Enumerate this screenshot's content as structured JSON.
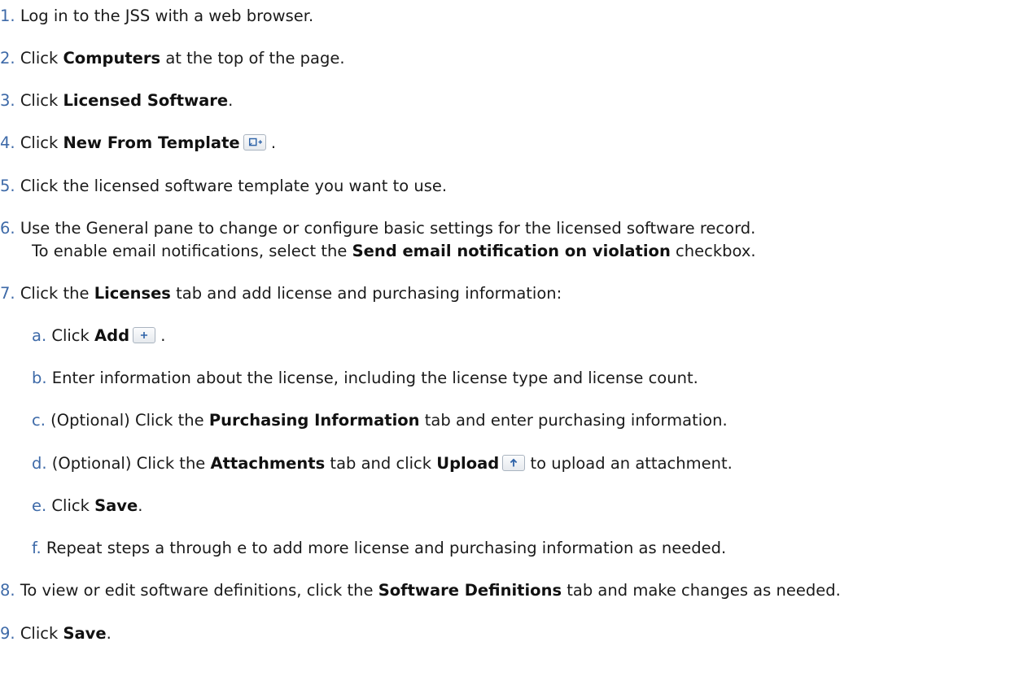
{
  "steps": [
    {
      "num": "1.",
      "text": "Log in to the JSS with a web browser."
    },
    {
      "num": "2.",
      "pre": "Click ",
      "bold": "Computers",
      "post": " at the top of the page."
    },
    {
      "num": "3.",
      "pre": "Click ",
      "bold": "Licensed Software",
      "post": "."
    },
    {
      "num": "4.",
      "pre": "Click ",
      "bold": "New From Template",
      "post": " .",
      "icon": "new-from-template-icon"
    },
    {
      "num": "5.",
      "text": "Click the licensed software template you want to use."
    },
    {
      "num": "6.",
      "text": "Use the General pane to change or configure basic settings for the licensed software record.",
      "line2_pre": "To enable email notifications, select the ",
      "line2_bold": "Send email notification on violation",
      "line2_post": " checkbox."
    },
    {
      "num": "7.",
      "pre": "Click the ",
      "bold": "Licenses",
      "post": " tab and add license and purchasing information:"
    },
    {
      "num": "8.",
      "pre": "To view or edit software definitions, click the ",
      "bold": "Software Definitions",
      "post": " tab and make changes as needed."
    },
    {
      "num": "9.",
      "pre": "Click ",
      "bold": "Save",
      "post": "."
    }
  ],
  "substeps": [
    {
      "num": "a.",
      "pre": "Click ",
      "bold": "Add",
      "post": " .",
      "icon": "add-icon"
    },
    {
      "num": "b.",
      "text": "Enter information about the license, including the license type and license count."
    },
    {
      "num": "c.",
      "pre": "(Optional) Click the ",
      "bold": "Purchasing Information",
      "post": " tab and enter purchasing information."
    },
    {
      "num": "d.",
      "pre": "(Optional) Click the ",
      "bold": "Attachments",
      "mid": " tab and click ",
      "bold2": "Upload",
      "post": " to upload an attachment.",
      "icon": "upload-icon"
    },
    {
      "num": "e.",
      "pre": "Click ",
      "bold": "Save",
      "post": "."
    },
    {
      "num": "f.",
      "text": "Repeat steps a through e to add more license and purchasing information as needed."
    }
  ]
}
